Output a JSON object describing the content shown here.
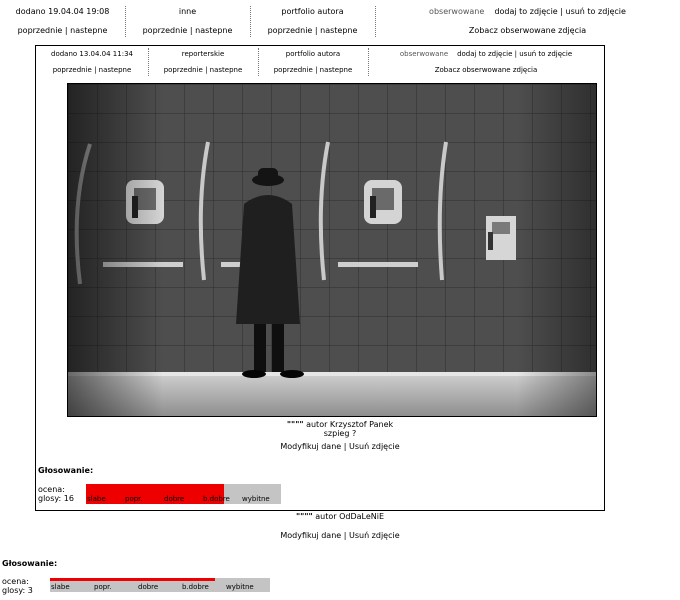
{
  "outer_nav": {
    "added": "dodano 19.04.04 19:08",
    "category": "inne",
    "portfolio": "portfolio autora",
    "observed_label": "obserwowane",
    "add_remove": "dodaj to zdjęcie | usuń to zdjęcie",
    "prev_next_1": "poprzednie | nastepne",
    "prev_next_2": "poprzednie | nastepne",
    "prev_next_3": "poprzednie | nastepne",
    "see_observed": "Zobacz obserwowane zdjęcia"
  },
  "inner_nav": {
    "added": "dodano 13.04.04 11:34",
    "category": "reporterskie",
    "portfolio": "portfolio autora",
    "observed_label": "obserwowane",
    "add_remove": "dodaj to zdjęcie | usuń to zdjęcie",
    "prev_next_1": "poprzednie | nastepne",
    "prev_next_2": "poprzednie | nastepne",
    "prev_next_3": "poprzednie | nastepne",
    "see_observed": "Zobacz obserwowane zdjęcia"
  },
  "inner_photo": {
    "stars": "\"\"\"\"",
    "author_prefix": "autor",
    "author": "Krzysztof Panek",
    "title": "szpieg ?",
    "modify": "Modyfikuj dane",
    "remove": "Usuń zdjęcie"
  },
  "inner_vote": {
    "title": "Głosowanie:",
    "rating_label": "ocena:",
    "votes_label": "glosy: 16",
    "fill_fraction": 0.71,
    "labels": [
      "slabe",
      "popr.",
      "dobre",
      "b.dobre",
      "wybitne"
    ]
  },
  "outer_photo": {
    "stars": "\"\"\"\"",
    "author_prefix": "autor",
    "author": "OdDaLeNiE",
    "modify": "Modyfikuj dane",
    "remove": "Usuń zdjęcie"
  },
  "outer_vote": {
    "title": "Głosowanie:",
    "rating_label": "ocena:",
    "votes_label": "glosy: 3",
    "fill_fraction": 0.75,
    "labels": [
      "slabe",
      "popr.",
      "dobre",
      "b.dobre",
      "wybitne"
    ]
  },
  "colors": {
    "vote_fill": "#ee0000",
    "vote_bg": "#c4c4c4"
  }
}
